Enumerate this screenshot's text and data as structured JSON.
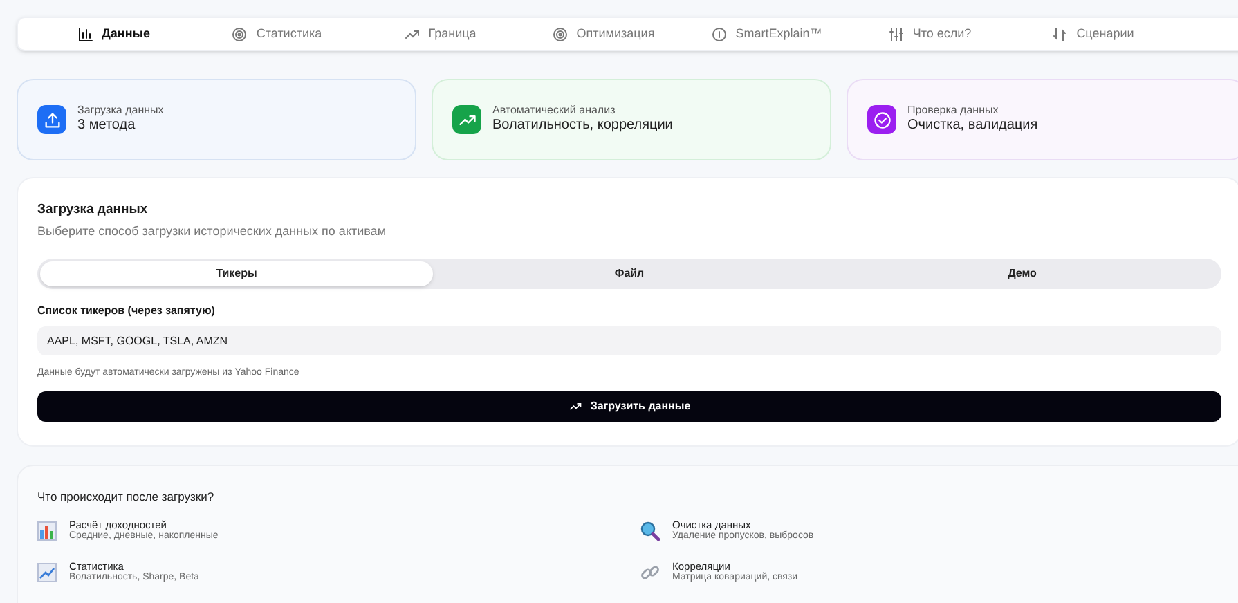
{
  "nav_tabs": [
    {
      "label": "Данные",
      "kind": "bars",
      "selected": true
    },
    {
      "label": "Статистика",
      "kind": "target",
      "selected": false
    },
    {
      "label": "Граница",
      "kind": "trend",
      "selected": false
    },
    {
      "label": "Оптимизация",
      "kind": "target",
      "selected": false
    },
    {
      "label": "SmartExplain™",
      "kind": "info",
      "selected": false
    },
    {
      "label": "Что если?",
      "kind": "sliders",
      "selected": false
    },
    {
      "label": "Сценарии",
      "kind": "swap",
      "selected": false
    }
  ],
  "feature_cards": [
    {
      "title": "Загрузка данных",
      "subtitle": "3 метода",
      "kind": "upload",
      "color": "#1d6ef5"
    },
    {
      "title": "Автоматический анализ",
      "subtitle": "Волатильность, корреляции",
      "kind": "trend",
      "color": "#16a34a"
    },
    {
      "title": "Проверка данных",
      "subtitle": "Очистка, валидация",
      "kind": "check",
      "color": "#9b1ff0"
    }
  ],
  "upload_panel": {
    "title": "Загрузка данных",
    "description": "Выберите способ загрузки исторических данных по активам",
    "methods": [
      {
        "label": "Тикеры",
        "selected": true
      },
      {
        "label": "Файл",
        "selected": false
      },
      {
        "label": "Демо",
        "selected": false
      }
    ],
    "field_label": "Список тикеров (через запятую)",
    "field_value": "AAPL, MSFT, GOOGL, TSLA, AMZN",
    "hint": "Данные будут автоматически загружены из Yahoo Finance",
    "button": "Загрузить данные"
  },
  "after_panel": {
    "title": "Что происходит после загрузки?",
    "items": [
      {
        "title": "Расчёт доходностей",
        "subtitle": "Средние, дневные, накопленные",
        "kind": "chart"
      },
      {
        "title": "Очистка данных",
        "subtitle": "Удаление пропусков, выбросов",
        "kind": "magnifier"
      },
      {
        "title": "Статистика",
        "subtitle": "Волатильность, Sharpe, Beta",
        "kind": "line"
      },
      {
        "title": "Корреляции",
        "subtitle": "Матрица ковариаций, связи",
        "kind": "link"
      }
    ]
  }
}
